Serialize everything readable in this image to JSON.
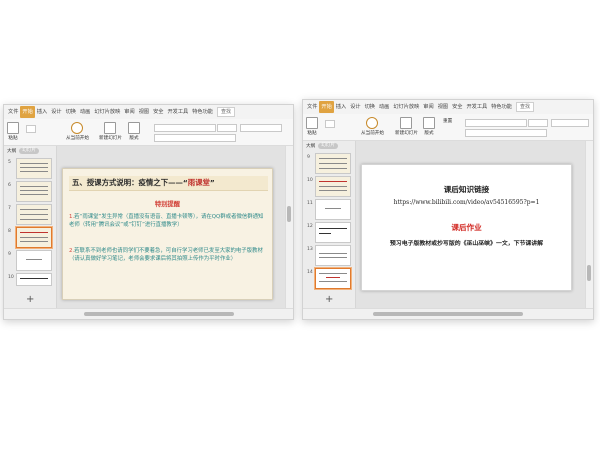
{
  "ribbon_tabs": [
    "开始",
    "插入",
    "设计",
    "切换",
    "动画",
    "幻灯片放映",
    "审阅",
    "视图",
    "安全",
    "开发工具",
    "特色功能"
  ],
  "file_menu": "文件",
  "search_label": "查找",
  "toolbar": {
    "paste": "粘贴",
    "slide_play": "从当前开始",
    "new_slide": "新建幻灯片",
    "layout": "版式",
    "reset": "重置"
  },
  "panel": {
    "outline": "大纲",
    "slides": "幻灯片"
  },
  "add_slide": "+",
  "left": {
    "thumb_numbers": [
      "5",
      "6",
      "7",
      "8",
      "9",
      "10"
    ],
    "slide": {
      "title_prefix": "五、授课方式说明：疫情之下——“",
      "title_highlight": "雨课堂",
      "title_suffix": "”",
      "notice": "特别提醒",
      "para1_num": "1.",
      "para1": "若“雨课堂”发生异常（直播没有语音、直播卡顿等），请在QQ群或者微信群通知老师（转用“腾讯会议”或“钉钉”进行直播教学）",
      "para2_num": "2.",
      "para2": "若联系不到老师也请同学们不要着急，可自行学习老师已发至大家的电子版教材（请认真做好学习笔记，老师会要求课后将其拍照上传作为平时作业）"
    }
  },
  "right": {
    "thumb_numbers": [
      "9",
      "10",
      "11",
      "12",
      "13",
      "14"
    ],
    "slide": {
      "heading1": "课后知识链接",
      "url": "https://www.bilibili.com/video/av54516595?p=1",
      "heading2": "课后作业",
      "description": "预习电子版教材或抄写版的《巫山巫峡》一文，下节课讲解"
    }
  }
}
